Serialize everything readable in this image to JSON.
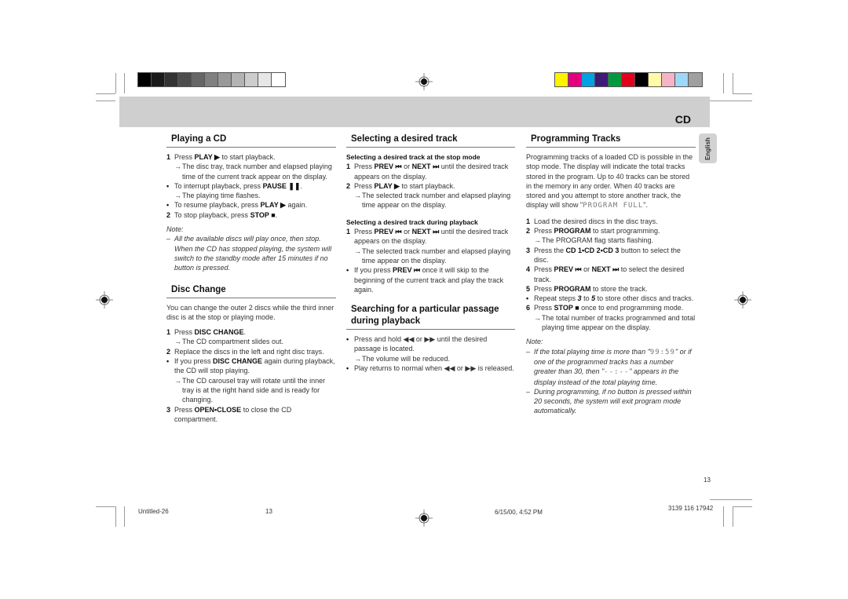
{
  "header": {
    "section_title": "CD",
    "language_tab": "English"
  },
  "color_bars": {
    "grayscale": [
      "#000000",
      "#1a1a1a",
      "#333333",
      "#4d4d4d",
      "#666666",
      "#808080",
      "#999999",
      "#b3b3b3",
      "#cccccc",
      "#e6e6e6",
      "#ffffff"
    ],
    "colors": [
      "#fff200",
      "#e5007e",
      "#00a0e4",
      "#3d1a78",
      "#009a3e",
      "#e2001a",
      "#000000",
      "#fffaa8",
      "#f6b3c8",
      "#9fd8f5",
      "#a0a0a0"
    ]
  },
  "col1": {
    "playing": {
      "title": "Playing a CD",
      "step1_num": "1",
      "step1_pre": "Press ",
      "step1_btn": "PLAY ▶",
      "step1_post": " to start playback.",
      "step1_arrow": "The disc tray, track number and elapsed playing time of the current track appear on the display.",
      "bullet1_pre": "To interrupt playback, press ",
      "bullet1_btn": "PAUSE ❚❚",
      "bullet1_post": ".",
      "bullet1_arrow": "The playing time flashes.",
      "bullet2_pre": "To resume playback, press ",
      "bullet2_btn": "PLAY ▶",
      "bullet2_post": " again.",
      "step2_num": "2",
      "step2_pre": "To stop playback, press ",
      "step2_btn": "STOP ■",
      "step2_post": ".",
      "note_label": "Note:",
      "note1": "All the available discs will play once,  then stop. When the CD has stopped playing, the system will switch to the standby mode after 15 minutes if no button is pressed."
    },
    "disc_change": {
      "title": "Disc Change",
      "intro": "You can change the outer 2 discs while the third inner disc is at the stop or playing mode.",
      "step1_num": "1",
      "step1_pre": "Press ",
      "step1_btn": "DISC CHANGE",
      "step1_post": ".",
      "step1_arrow": "The CD compartment slides out.",
      "step2_num": "2",
      "step2": "Replace the discs in the left and right disc trays.",
      "bullet_pre": "If you press ",
      "bullet_btn": "DISC CHANGE",
      "bullet_post": " again during playback, the CD will stop playing.",
      "bullet_arrow": "The CD carousel tray will rotate until the inner tray is at the right hand side and is ready for changing.",
      "step3_num": "3",
      "step3_pre": "Press ",
      "step3_btn": "OPEN•CLOSE",
      "step3_post": " to close the CD compartment."
    }
  },
  "col2": {
    "selecting": {
      "title": "Selecting a desired track",
      "sub1": "Selecting a desired track at the stop mode",
      "s1_step1_num": "1",
      "s1_step1_pre": "Press ",
      "s1_step1_btn1": "PREV ⏮",
      "s1_step1_mid": " or ",
      "s1_step1_btn2": "NEXT ⏭",
      "s1_step1_post": " until the desired track appears on the display.",
      "s1_step2_num": "2",
      "s1_step2_pre": "Press ",
      "s1_step2_btn": "PLAY ▶",
      "s1_step2_post": " to start playback.",
      "s1_step2_arrow": "The selected track number and elapsed playing time appear on the display.",
      "sub2": "Selecting a desired track during playback",
      "s2_step1_num": "1",
      "s2_step1_pre": "Press ",
      "s2_step1_btn1": "PREV ⏮",
      "s2_step1_mid": " or ",
      "s2_step1_btn2": "NEXT ⏭",
      "s2_step1_post": " until the desired track appears on the display.",
      "s2_step1_arrow": "The selected track number and elapsed playing time appear on the display.",
      "s2_bullet_pre": "If you press ",
      "s2_bullet_btn": "PREV ⏮",
      "s2_bullet_post": " once it will skip to the beginning of the current track and play the track again."
    },
    "searching": {
      "title": "Searching for a particular passage during playback",
      "bullet1": "Press and hold ◀◀ or ▶▶ until the desired passage is located.",
      "bullet1_arrow": "The volume will be  reduced.",
      "bullet2": "Play returns to normal when ◀◀ or ▶▶ is released."
    }
  },
  "col3": {
    "programming": {
      "title": "Programming Tracks",
      "intro": "Programming tracks of a loaded CD is possible in the stop mode. The display will indicate the total tracks stored in the program. Up to 40 tracks can be stored in the memory in any order. When 40 tracks are stored and you attempt to store another track, the display will show \"",
      "intro_lcd": "PROGRAM FULL",
      "intro_end": "\".",
      "step1_num": "1",
      "step1": "Load the desired discs in the disc trays.",
      "step2_num": "2",
      "step2_pre": "Press ",
      "step2_btn": "PROGRAM",
      "step2_post": " to start programming.",
      "step2_arrow": "The PROGRAM flag starts flashing.",
      "step3_num": "3",
      "step3_pre": "Press the ",
      "step3_btn": "CD 1•CD 2•CD 3",
      "step3_post": " button to select the disc.",
      "step4_num": "4",
      "step4_pre": "Press ",
      "step4_btn1": "PREV ⏮",
      "step4_mid": " or ",
      "step4_btn2": "NEXT ⏭",
      "step4_post": " to select the desired track.",
      "step5_num": "5",
      "step5_pre": "Press ",
      "step5_btn": "PROGRAM",
      "step5_post": " to store the track.",
      "bullet_pre": "Repeat steps ",
      "bullet_a": "3",
      "bullet_mid": " to ",
      "bullet_b": "5",
      "bullet_post": " to store other discs and tracks.",
      "step6_num": "6",
      "step6_pre": "Press ",
      "step6_btn": "STOP ■",
      "step6_post": " once to end programming mode.",
      "step6_arrow": "The total number of tracks programmed and total playing time appear on the display.",
      "note_label": "Note:",
      "note1_pre": "If the total playing time is more than  \"",
      "note1_lcd": "99:59",
      "note1_mid": "\" or if one of the programmed tracks has a number greater than 30, then \"",
      "note1_lcd2": "--:--",
      "note1_post": "\" appears in the display instead of the total playing time.",
      "note2": "During programming,  if no button is pressed within 20 seconds, the system will exit program mode automatically."
    }
  },
  "page_number": "13",
  "footer": {
    "file": "Untitled-26",
    "page": "13",
    "datetime": "6/15/00, 4:52 PM",
    "code": "3139 116 17942"
  }
}
